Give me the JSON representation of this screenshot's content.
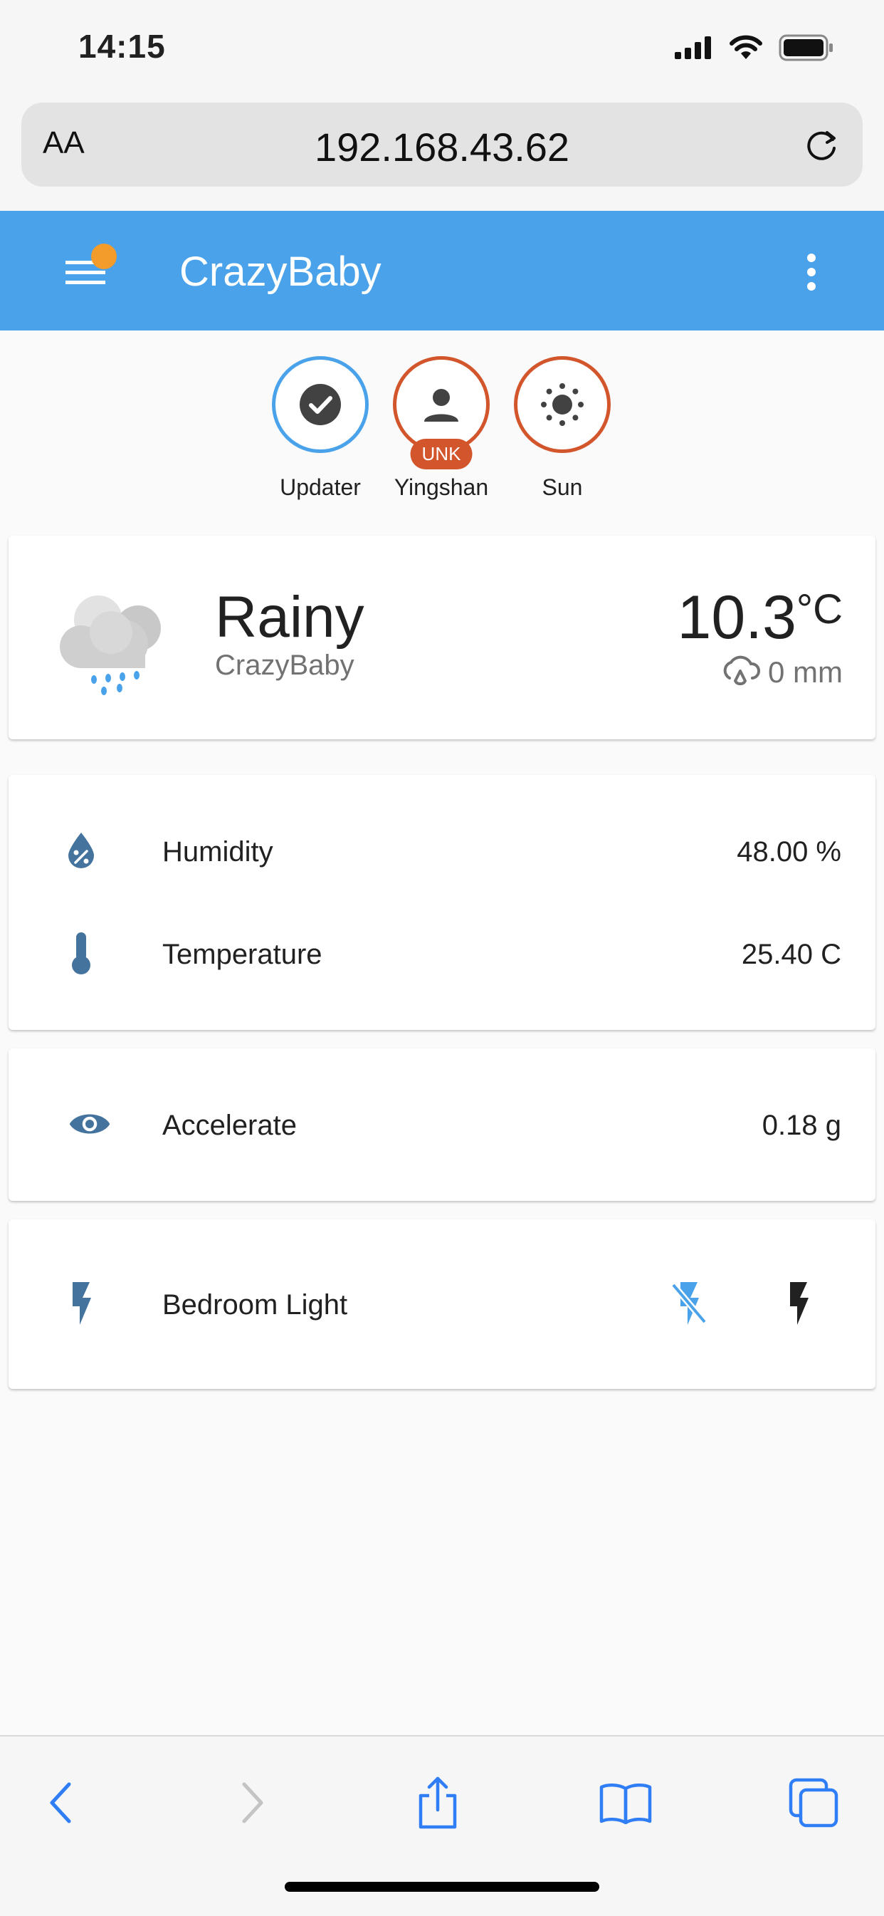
{
  "status_bar": {
    "time": "14:15"
  },
  "browser": {
    "text_size_button": "AA",
    "url": "192.168.43.62"
  },
  "app": {
    "title": "CrazyBaby"
  },
  "badges": [
    {
      "label": "Updater",
      "icon": "check-circle-icon",
      "color": "#4aa3ea"
    },
    {
      "label": "Yingshan",
      "icon": "person-icon",
      "color": "#d2552b",
      "status": "UNK"
    },
    {
      "label": "Sun",
      "icon": "sun-icon",
      "color": "#d2552b"
    }
  ],
  "weather": {
    "condition": "Rainy",
    "location": "CrazyBaby",
    "temperature": "10.3",
    "unit": "°C",
    "precipitation": "0 mm",
    "icon": "rainy-cloud-icon"
  },
  "sensors": [
    {
      "name": "Humidity",
      "value": "48.00 %",
      "icon": "water-percent-icon"
    },
    {
      "name": "Temperature",
      "value": "25.40 C",
      "icon": "thermometer-icon"
    }
  ],
  "accelerate": {
    "name": "Accelerate",
    "value": "0.18 g",
    "icon": "eye-icon"
  },
  "light": {
    "name": "Bedroom Light",
    "icon": "flash-icon",
    "off_icon": "flash-off-icon",
    "on_icon": "flash-on-icon"
  },
  "colors": {
    "accent": "#4aa3ea",
    "entity_icon": "#44739e",
    "badge_warning": "#d2552b",
    "notification": "#f39c2c"
  }
}
